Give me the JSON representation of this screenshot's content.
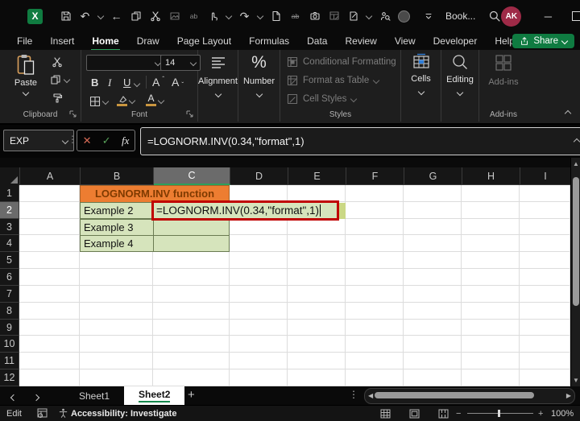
{
  "colors": {
    "accent_green": "#107C41",
    "title_cell_orange": "#ED7D31",
    "example_cell_green": "#D6E4BC",
    "edit_border_red": "#C00000",
    "selected_header_gray": "#6B6B6B",
    "avatar_red": "#9E2A47"
  },
  "title_bar": {
    "document_title": "Book...",
    "avatar_initials": "AK",
    "qat_icons": [
      "excel-logo",
      "save",
      "undo",
      "back",
      "copy",
      "cut",
      "paste-picture",
      "spelling",
      "touch-mode",
      "redo",
      "new-document",
      "strikethrough",
      "camera",
      "table-edit",
      "signature",
      "people-search",
      "presence-circle",
      "qat-overflow",
      "search"
    ]
  },
  "menu": {
    "tabs": [
      "File",
      "Insert",
      "Home",
      "Draw",
      "Page Layout",
      "Formulas",
      "Data",
      "Review",
      "View",
      "Developer",
      "Help"
    ],
    "active_tab": "Home",
    "share_label": "Share"
  },
  "ribbon": {
    "clipboard": {
      "paste_label": "Paste",
      "group_label": "Clipboard"
    },
    "font": {
      "size_value": "14",
      "bold": "B",
      "italic": "I",
      "underline": "U",
      "group_label": "Font"
    },
    "alignment": {
      "label": "Alignment"
    },
    "number": {
      "label": "Number"
    },
    "styles": {
      "items": [
        "Conditional Formatting",
        "Format as Table",
        "Cell Styles"
      ],
      "group_label": "Styles"
    },
    "cells": {
      "label": "Cells"
    },
    "editing": {
      "label": "Editing"
    },
    "addins": {
      "label": "Add-ins",
      "group_label": "Add-ins"
    }
  },
  "formula_bar": {
    "name_box_value": "EXP",
    "fx_label": "fx",
    "formula": "=LOGNORM.INV(0.34,\"format\",1)"
  },
  "grid": {
    "column_headers": [
      "A",
      "B",
      "C",
      "D",
      "E",
      "F",
      "G",
      "H",
      "I"
    ],
    "selected_column": "C",
    "row_headers": [
      "1",
      "2",
      "3",
      "4",
      "5",
      "6",
      "7",
      "8",
      "9",
      "10",
      "11",
      "12"
    ],
    "selected_row": "2",
    "cells": {
      "title": "LOGNORM.INV function",
      "b2": "Example 2",
      "b3": "Example 3",
      "b4": "Example 4",
      "c2_edit": "=LOGNORM.INV(0.34,\"format\",1)"
    }
  },
  "sheet_bar": {
    "tabs": [
      "Sheet1",
      "Sheet2"
    ],
    "active_tab": "Sheet2",
    "add_label": "+"
  },
  "status_bar": {
    "mode": "Edit",
    "accessibility_label": "Accessibility: Investigate",
    "zoom_value": "100%"
  }
}
